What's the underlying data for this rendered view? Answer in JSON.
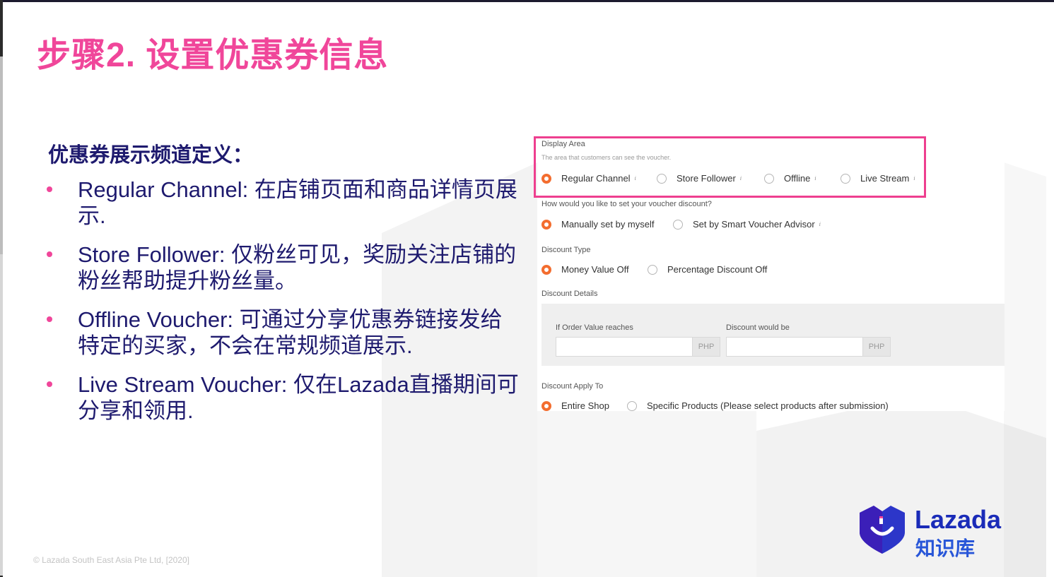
{
  "slide": {
    "title": "步骤2. 设置优惠券信息",
    "subheading": "优惠券展示频道定义：",
    "bullets": [
      "Regular Channel: 在店铺页面和商品详情页展示.",
      "Store Follower: 仅粉丝可见，奖励关注店铺的粉丝帮助提升粉丝量。",
      "Offline Voucher: 可通过分享优惠券链接发给特定的买家，不会在常规频道展示.",
      "Live Stream Voucher: 仅在Lazada直播期间可分享和领用."
    ],
    "copyright": "© Lazada South East Asia Pte Ltd, [2020]",
    "logo": {
      "brand": "Lazada",
      "sub": "知识库"
    }
  },
  "form": {
    "display_area": {
      "label": "Display Area",
      "hint": "The area that customers can see the voucher.",
      "options": [
        "Regular Channel",
        "Store Follower",
        "Offline",
        "Live Stream"
      ],
      "selected": "Regular Channel"
    },
    "discount_setting": {
      "label": "How would you like to set your voucher discount?",
      "options": [
        "Manually set by myself",
        "Set by Smart Voucher Advisor"
      ],
      "selected": "Manually set by myself"
    },
    "discount_type": {
      "label": "Discount Type",
      "options": [
        "Money Value Off",
        "Percentage Discount Off"
      ],
      "selected": "Money Value Off"
    },
    "discount_details": {
      "label": "Discount Details",
      "order_value_label": "If Order Value reaches",
      "discount_label": "Discount would be",
      "currency": "PHP",
      "order_value": "",
      "discount_value": ""
    },
    "apply_to": {
      "label": "Discount Apply To",
      "options": [
        "Entire Shop",
        "Specific Products (Please select products after submission)"
      ],
      "selected": "Entire Shop"
    }
  },
  "colors": {
    "title_pink": "#f0469a",
    "text_navy": "#1e1a6e",
    "radio_orange": "#f36d2f",
    "highlight_border": "#ee3f8f",
    "logo_blue": "#1a2bb8"
  }
}
